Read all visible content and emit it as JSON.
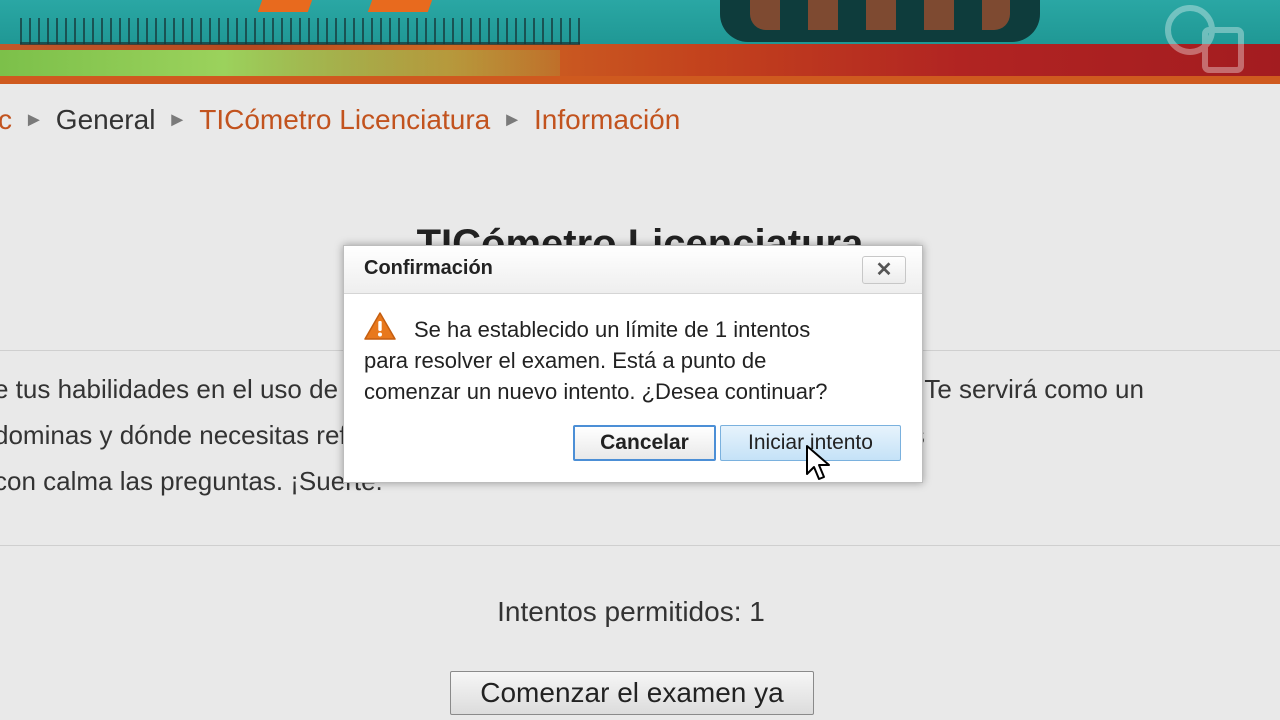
{
  "breadcrumb": {
    "items": [
      "c",
      "General",
      "TICómetro Licenciatura",
      "Información"
    ],
    "separator": "►"
  },
  "quiz": {
    "title": "TICómetro Licenciatura",
    "intro_lines": [
      "e tus habilidades en el uso de las tecnologías de la información y comunicación. Te servirá como un",
      "dominas y dónde necesitas reforzar para tus actividades escolares. Sigue las ins",
      "con calma las preguntas. ¡Suerte."
    ],
    "attempts_text": "Intentos permitidos: 1",
    "start_button": "Comenzar el examen ya"
  },
  "dialog": {
    "title": "Confirmación",
    "message_lines": [
      "Se ha establecido un límite de 1 intentos",
      "para resolver el examen. Está a punto de",
      "comenzar un nuevo intento. ¿Desea continuar?"
    ],
    "close_label": "✕",
    "cancel_label": "Cancelar",
    "confirm_label": "Iniciar intento"
  },
  "colors": {
    "link": "#c2531e",
    "banner_teal": "#1f9794",
    "banner_orange": "#cf5a1f",
    "warning": "#e8781c",
    "primary_focus": "#4c8fd6"
  },
  "icons": {
    "warning": "warning-icon",
    "close": "close-icon",
    "cursor": "mouse-cursor-icon"
  }
}
